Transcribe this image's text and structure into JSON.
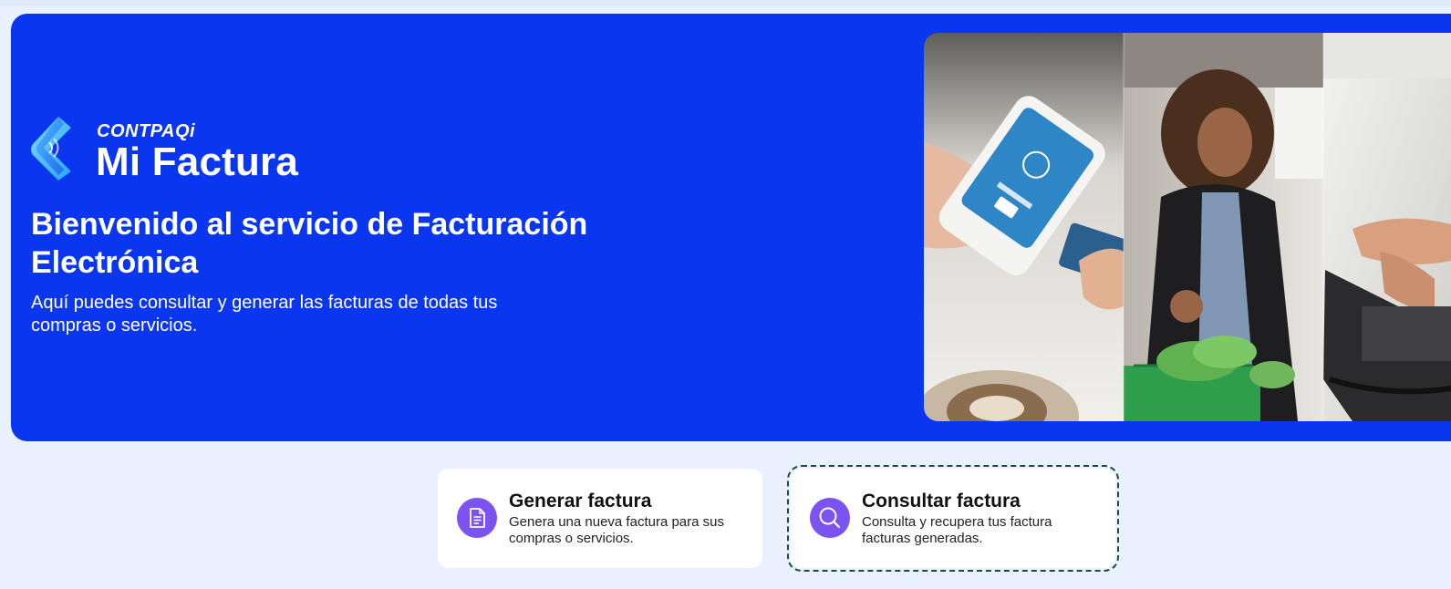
{
  "brand": {
    "company": "CONTPAQi",
    "product": "Mi Factura"
  },
  "hero": {
    "title": "Bienvenido al servicio de Facturación Electrónica",
    "subtitle": "Aquí puedes consultar y generar las facturas de todas tus compras o servicios.",
    "photos": [
      "card-payment-terminal-photo",
      "woman-shopping-photo",
      "checkout-counter-photo"
    ]
  },
  "actions": [
    {
      "title": "Generar factura",
      "description": "Genera una nueva factura para sus compras o servicios.",
      "icon": "document-icon"
    },
    {
      "title": "Consultar factura",
      "description": "Consulta y recupera tus factura facturas generadas.",
      "icon": "search-icon"
    }
  ],
  "colors": {
    "hero_background": "#0a36f0",
    "page_background": "#e9f1fe",
    "icon_accent": "#7b53f0",
    "focus_outline": "#1b4d3e"
  }
}
